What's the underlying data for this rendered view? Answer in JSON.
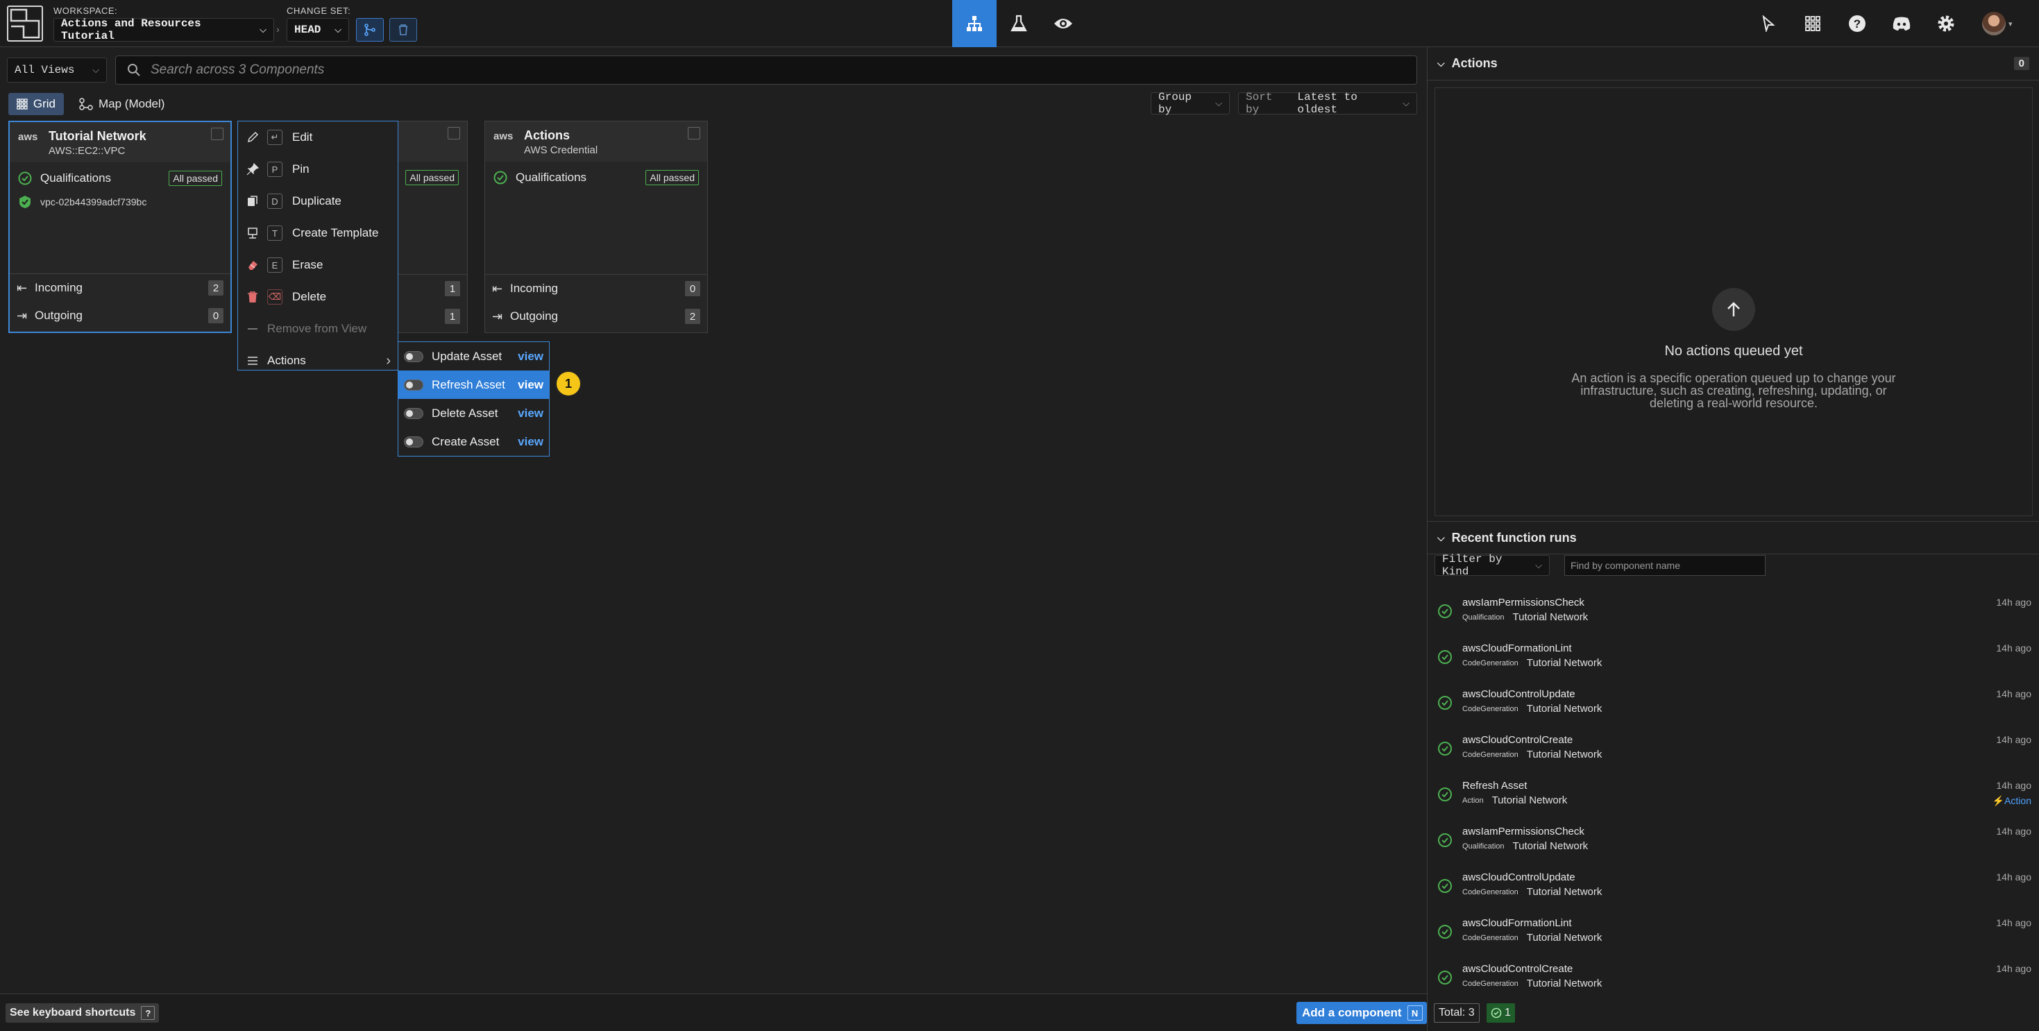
{
  "topbar": {
    "workspace_label": "WORKSPACE:",
    "workspace_value": "Actions and Resources Tutorial",
    "changeset_label": "CHANGE SET:",
    "changeset_value": "HEAD",
    "nav": [
      {
        "icon": "diagram-icon",
        "active": true
      },
      {
        "icon": "flask-icon",
        "active": false
      },
      {
        "icon": "eye-icon",
        "active": false
      }
    ],
    "right_icons": [
      "cursor-icon",
      "grid-apps-icon",
      "help-icon",
      "discord-icon",
      "gear-icon",
      "avatar"
    ]
  },
  "toolbar": {
    "views_value": "All Views",
    "search_placeholder": "Search across 3 Components",
    "grid_label": "Grid",
    "map_label": "Map (Model)",
    "group_by_label": "Group by",
    "sort_by_prefix": "Sort by",
    "sort_by_value": "Latest to oldest"
  },
  "cards": [
    {
      "title": "Tutorial Network",
      "subtitle": "AWS::EC2::VPC",
      "logo": "aws",
      "qualifications_label": "Qualifications",
      "qualifications_status": "All passed",
      "resource_id": "vpc-02b44399adcf739bc",
      "incoming_label": "Incoming",
      "incoming_count": "2",
      "outgoing_label": "Outgoing",
      "outgoing_count": "0"
    },
    {
      "qualifications_status": "All passed",
      "incoming_count": "1",
      "outgoing_count": "1"
    },
    {
      "title": "Actions",
      "subtitle": "AWS Credential",
      "logo": "aws",
      "qualifications_label": "Qualifications",
      "qualifications_status": "All passed",
      "incoming_label": "Incoming",
      "incoming_count": "0",
      "outgoing_label": "Outgoing",
      "outgoing_count": "2"
    }
  ],
  "context_menu": {
    "items": [
      {
        "label": "Edit",
        "key": "↵"
      },
      {
        "label": "Pin",
        "key": "P"
      },
      {
        "label": "Duplicate",
        "key": "D"
      },
      {
        "label": "Create Template",
        "key": "T"
      },
      {
        "label": "Erase",
        "key": "E"
      },
      {
        "label": "Delete",
        "key": "⌫"
      },
      {
        "label": "Remove from View"
      },
      {
        "label": "Actions"
      }
    ]
  },
  "actions_submenu": {
    "view_label": "view",
    "items": [
      {
        "label": "Update Asset",
        "active": false
      },
      {
        "label": "Refresh Asset",
        "active": true
      },
      {
        "label": "Delete Asset",
        "active": false
      },
      {
        "label": "Create Asset",
        "active": false
      }
    ]
  },
  "marker": "1",
  "actions_panel": {
    "title": "Actions",
    "count": "0",
    "empty_title": "No actions queued yet",
    "empty_desc": "An action is a specific operation queued up to change your infrastructure, such as creating, refreshing, updating, or deleting a real-world resource."
  },
  "runs_panel": {
    "title": "Recent function runs",
    "filter_value": "Filter by Kind",
    "find_placeholder": "Find by component name",
    "runs": [
      {
        "name": "awsIamPermissionsCheck",
        "kind": "Qualification",
        "component": "Tutorial Network",
        "ago": "14h ago"
      },
      {
        "name": "awsCloudFormationLint",
        "kind": "CodeGeneration",
        "component": "Tutorial Network",
        "ago": "14h ago"
      },
      {
        "name": "awsCloudControlUpdate",
        "kind": "CodeGeneration",
        "component": "Tutorial Network",
        "ago": "14h ago"
      },
      {
        "name": "awsCloudControlCreate",
        "kind": "CodeGeneration",
        "component": "Tutorial Network",
        "ago": "14h ago"
      },
      {
        "name": "Refresh Asset",
        "kind": "Action",
        "component": "Tutorial Network",
        "ago": "14h ago",
        "tag": "Action"
      },
      {
        "name": "awsIamPermissionsCheck",
        "kind": "Qualification",
        "component": "Tutorial Network",
        "ago": "14h ago"
      },
      {
        "name": "awsCloudControlUpdate",
        "kind": "CodeGeneration",
        "component": "Tutorial Network",
        "ago": "14h ago"
      },
      {
        "name": "awsCloudFormationLint",
        "kind": "CodeGeneration",
        "component": "Tutorial Network",
        "ago": "14h ago"
      },
      {
        "name": "awsCloudControlCreate",
        "kind": "CodeGeneration",
        "component": "Tutorial Network",
        "ago": "14h ago"
      }
    ]
  },
  "bottombar": {
    "keyboard_label": "See keyboard shortcuts",
    "keyboard_key": "?",
    "add_label": "Add a component",
    "add_key": "N",
    "total_label": "Total: 3",
    "ok_count": "1"
  },
  "colors": {
    "accent": "#2f7ed8",
    "success": "#4caf50",
    "marker": "#f5c518"
  }
}
